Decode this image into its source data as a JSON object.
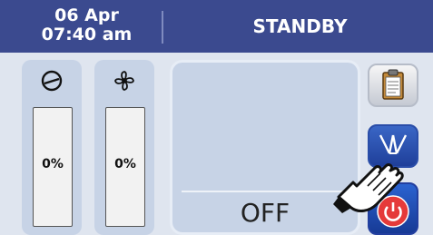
{
  "header": {
    "date": "06 Apr",
    "time": "07:40 am",
    "status": "STANDBY"
  },
  "gauges": [
    {
      "icon": "compressor-icon",
      "value_label": "0%",
      "level": 0
    },
    {
      "icon": "fan-icon",
      "value_label": "0%",
      "level": 0
    }
  ],
  "main": {
    "state": "OFF"
  },
  "buttons": [
    {
      "icon": "clipboard-icon"
    },
    {
      "icon": "mode-icon"
    },
    {
      "icon": "power-icon"
    }
  ],
  "colors": {
    "header": "#3b4a8f",
    "panel": "#c7d3e6",
    "background": "#dfe5ef",
    "button_blue": "#1f3f9a",
    "power_red": "#e53a3a"
  }
}
